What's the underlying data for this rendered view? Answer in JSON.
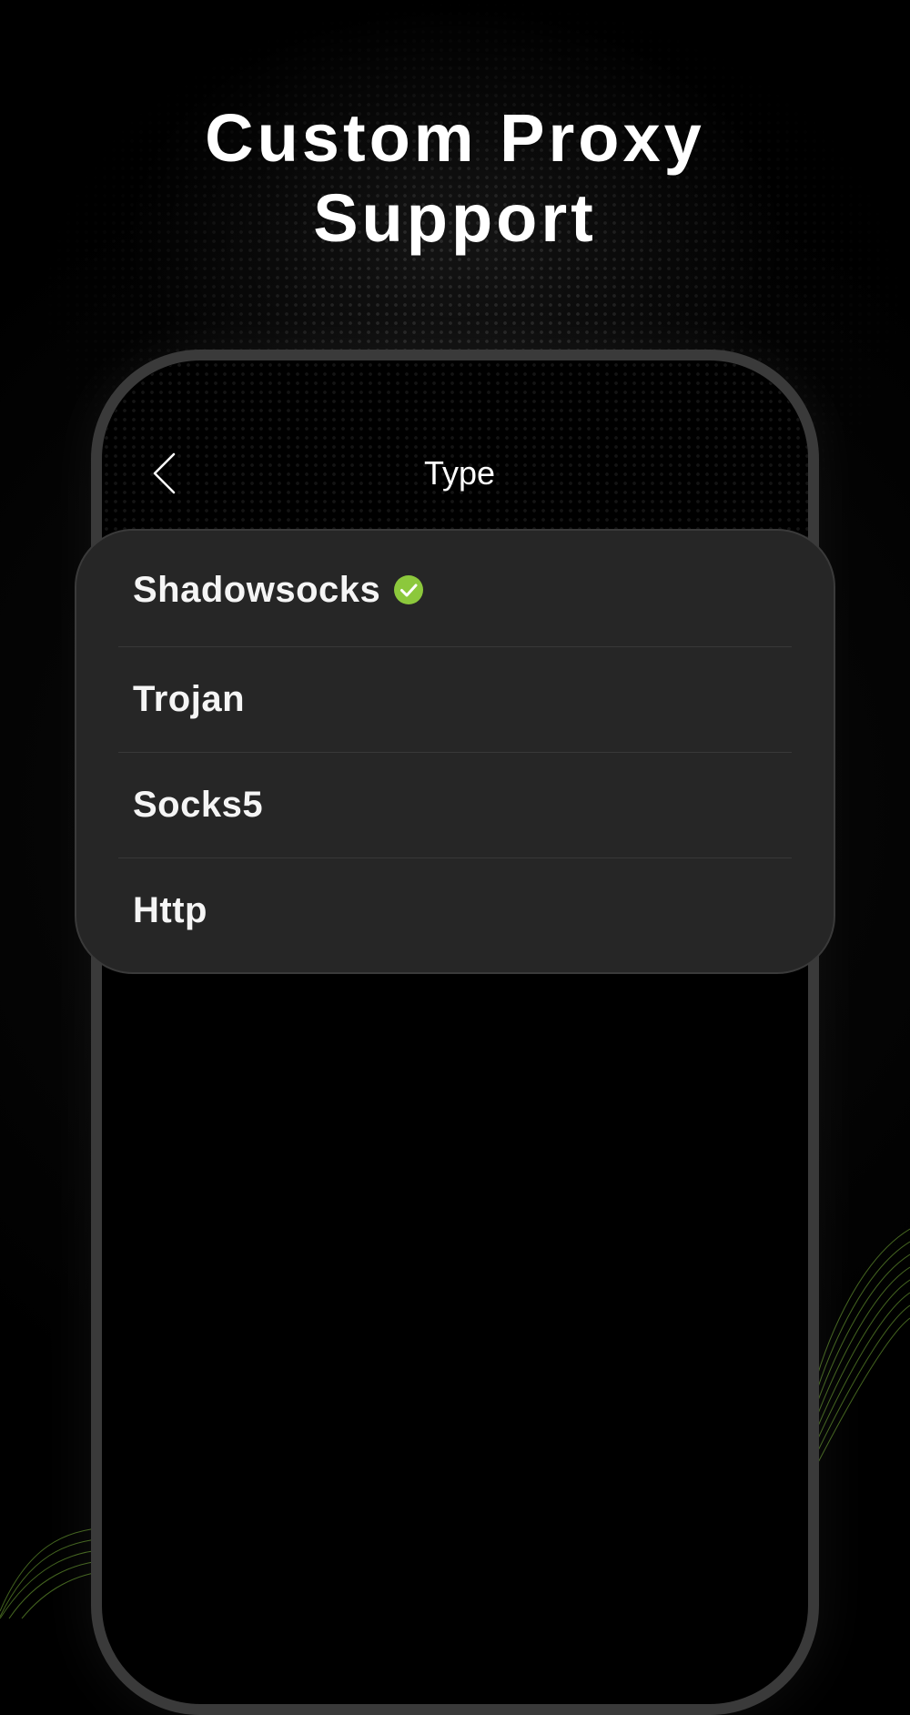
{
  "headline": {
    "line1": "Custom Proxy",
    "line2": "Support"
  },
  "nav": {
    "title": "Type",
    "back_icon": "chevron-left-icon"
  },
  "options": [
    {
      "label": "Shadowsocks",
      "selected": true
    },
    {
      "label": "Trojan",
      "selected": false
    },
    {
      "label": "Socks5",
      "selected": false
    },
    {
      "label": "Http",
      "selected": false
    }
  ],
  "colors": {
    "background": "#000000",
    "sheet": "#262626",
    "phone_frame": "#3a3a3a",
    "accent_green": "#8cc83c",
    "text": "#ffffff"
  }
}
